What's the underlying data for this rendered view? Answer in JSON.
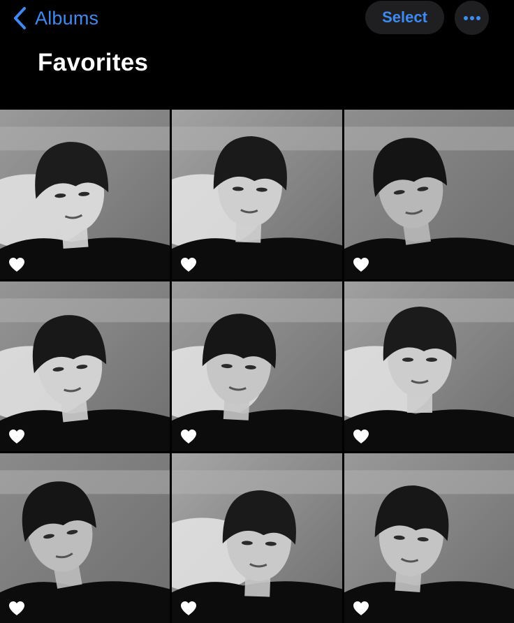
{
  "nav": {
    "back_label": "Albums",
    "select_label": "Select",
    "more_icon": "ellipsis-icon",
    "back_icon": "chevron-left-icon"
  },
  "title": "Favorites",
  "accent_color": "#3d8bf2",
  "photos": [
    {
      "favorite": true,
      "icon": "heart-icon"
    },
    {
      "favorite": true,
      "icon": "heart-icon"
    },
    {
      "favorite": true,
      "icon": "heart-icon"
    },
    {
      "favorite": true,
      "icon": "heart-icon"
    },
    {
      "favorite": true,
      "icon": "heart-icon"
    },
    {
      "favorite": true,
      "icon": "heart-icon"
    },
    {
      "favorite": true,
      "icon": "heart-icon"
    },
    {
      "favorite": true,
      "icon": "heart-icon"
    },
    {
      "favorite": true,
      "icon": "heart-icon"
    }
  ]
}
